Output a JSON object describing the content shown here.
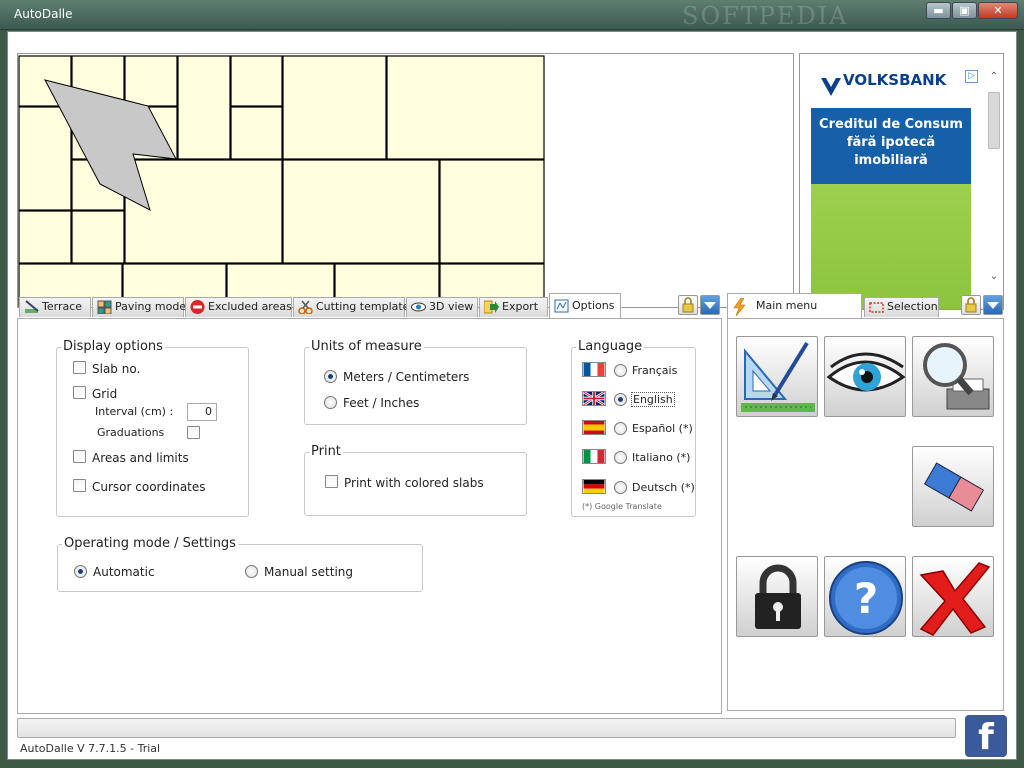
{
  "window": {
    "title": "AutoDalle",
    "watermark": "SOFTPEDIA",
    "minimize_label": "▬",
    "maximize_label": "▣",
    "close_label": "✕"
  },
  "ad": {
    "brand": "VOLKSBANK",
    "badge": "▷",
    "headline": "Creditul de Consum fără ipotecă imobiliară",
    "scroll_up": "⌃",
    "scroll_down": "⌄"
  },
  "tabs": [
    {
      "label": "Terrace",
      "icon": "terrace-icon"
    },
    {
      "label": "Paving model",
      "icon": "paving-icon"
    },
    {
      "label": "Excluded areas",
      "icon": "no-entry-icon"
    },
    {
      "label": "Cutting template",
      "icon": "scissors-icon"
    },
    {
      "label": "3D view",
      "icon": "eye-icon"
    },
    {
      "label": "Export",
      "icon": "export-arrow-icon"
    },
    {
      "label": "Options",
      "icon": "options-icon",
      "active": true
    }
  ],
  "right_tabs": [
    {
      "label": "Main menu",
      "icon": "lightning-icon",
      "active": true
    },
    {
      "label": "Selection",
      "icon": "selection-icon"
    }
  ],
  "options": {
    "display": {
      "title": "Display options",
      "slab_no": "Slab no.",
      "grid": "Grid",
      "interval_label": "Interval (cm) :",
      "interval_value": "0",
      "graduations": "Graduations",
      "areas_limits": "Areas and limits",
      "cursor_coords": "Cursor coordinates"
    },
    "units": {
      "title": "Units of measure",
      "metric": "Meters / Centimeters",
      "imperial": "Feet / Inches",
      "selected": "metric"
    },
    "print": {
      "title": "Print",
      "colored": "Print with colored slabs"
    },
    "mode": {
      "title": "Operating mode / Settings",
      "automatic": "Automatic",
      "manual": "Manual setting",
      "selected": "automatic"
    },
    "language": {
      "title": "Language",
      "items": [
        {
          "label": "Français",
          "flag": "flag-france-icon"
        },
        {
          "label": "English",
          "flag": "flag-uk-icon",
          "selected": true
        },
        {
          "label": "Español  (*)",
          "flag": "flag-spain-icon"
        },
        {
          "label": "Italiano  (*)",
          "flag": "flag-italy-icon"
        },
        {
          "label": "Deutsch   (*)",
          "flag": "flag-germany-icon"
        }
      ],
      "footnote": "(*) Google Translate"
    }
  },
  "status": {
    "version": "AutoDalle  V 7.7.1.5 - Trial",
    "facebook": "f"
  },
  "colors": {
    "slab_fill": "#ffffe0",
    "shape_fill": "#c8c8c8",
    "ad_blue": "#1560a8",
    "ad_green": "#8cc43e"
  }
}
